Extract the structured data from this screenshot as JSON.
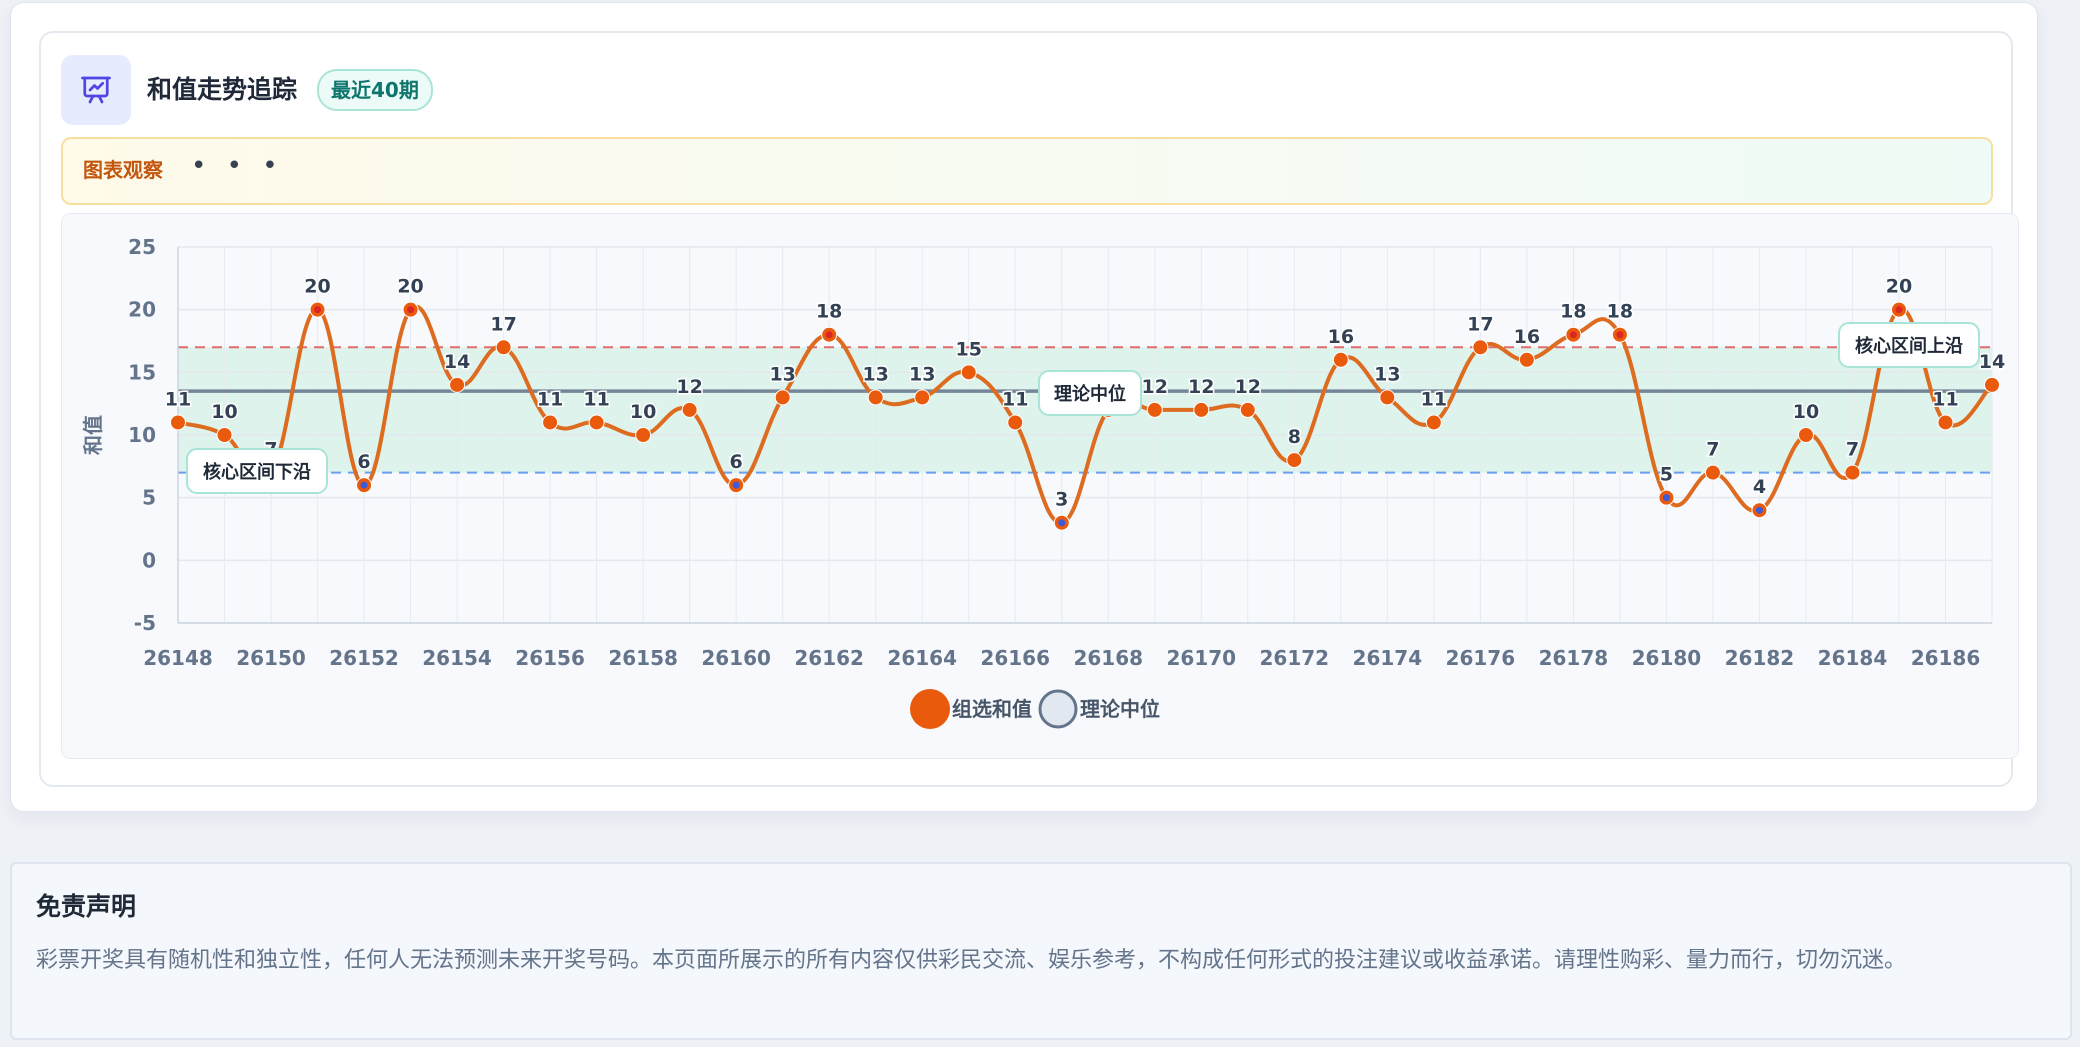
{
  "header": {
    "title": "和值走势追踪",
    "badge": "最近40期",
    "icon": "presentation-chart-icon"
  },
  "observation": {
    "label": "图表观察",
    "dots": "• • •"
  },
  "chart_data": {
    "type": "line",
    "x": [
      26148,
      26149,
      26150,
      26151,
      26152,
      26153,
      26154,
      26155,
      26156,
      26157,
      26158,
      26159,
      26160,
      26161,
      26162,
      26163,
      26164,
      26165,
      26166,
      26167,
      26168,
      26169,
      26170,
      26171,
      26172,
      26173,
      26174,
      26175,
      26176,
      26177,
      26178,
      26179,
      26180,
      26181,
      26182,
      26183,
      26184,
      26185,
      26186,
      26187
    ],
    "x_ticks": [
      26148,
      26150,
      26152,
      26154,
      26156,
      26158,
      26160,
      26162,
      26164,
      26166,
      26168,
      26170,
      26172,
      26174,
      26176,
      26178,
      26180,
      26182,
      26184,
      26186
    ],
    "series": [
      {
        "name": "组选和值",
        "color": "#ea5a0c",
        "line_color": "#dd6b20",
        "values": [
          11,
          10,
          7,
          20,
          6,
          20,
          14,
          17,
          11,
          11,
          10,
          12,
          6,
          13,
          18,
          13,
          13,
          15,
          11,
          3,
          12,
          12,
          12,
          12,
          8,
          16,
          13,
          11,
          17,
          16,
          18,
          18,
          5,
          7,
          4,
          10,
          7,
          20,
          11,
          14
        ]
      }
    ],
    "reference_lines": {
      "median": {
        "name": "理论中位",
        "value": 13.5,
        "color": "#64748b",
        "label": "理论中位"
      },
      "core_upper": {
        "value": 17,
        "color": "#e06c6c",
        "label": "核心区间上沿"
      },
      "core_lower": {
        "value": 7,
        "color": "#6b9ff0",
        "label": "核心区间下沿"
      }
    },
    "core_band": {
      "from": 7,
      "to": 17,
      "color": "#d5f0e6"
    },
    "highlight_colors": {
      "high": "#dc2626",
      "low": "#3b5bdb"
    },
    "ylabel": "和值",
    "xlabel": "",
    "ylim": [
      -5,
      25
    ],
    "y_ticks": [
      -5,
      0,
      5,
      10,
      15,
      20,
      25
    ],
    "grid": true,
    "legend_position": "bottom-center"
  },
  "legend": {
    "series_label": "组选和值",
    "median_label": "理论中位"
  },
  "disclaimer": {
    "title": "免责声明",
    "text": "彩票开奖具有随机性和独立性，任何人无法预测未来开奖号码。本页面所展示的所有内容仅供彩民交流、娱乐参考，不构成任何形式的投注建议或收益承诺。请理性购彩、量力而行，切勿沉迷。"
  }
}
